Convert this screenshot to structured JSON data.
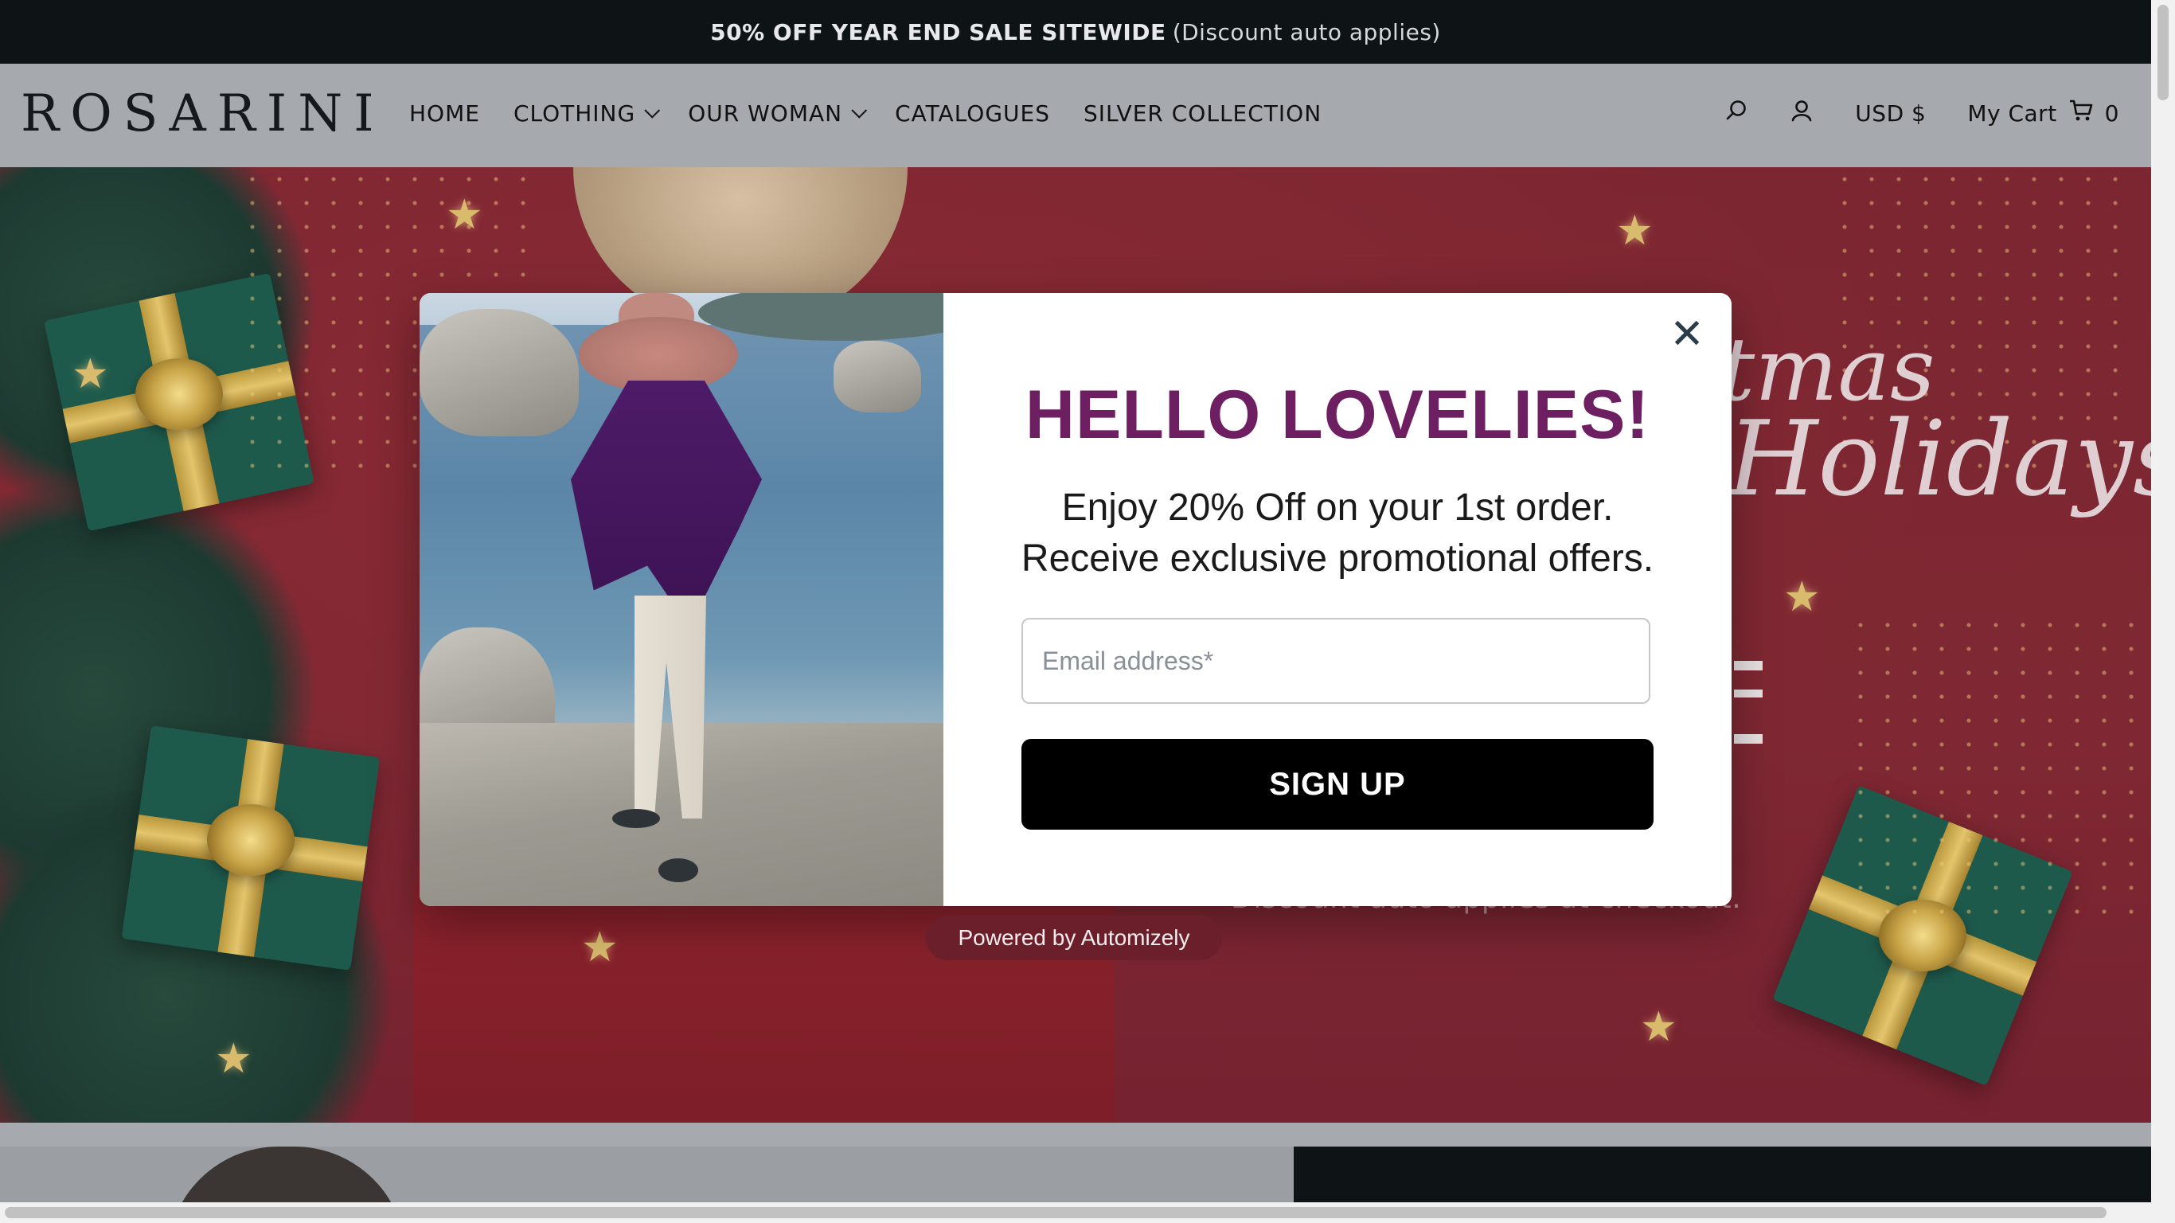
{
  "announcement": {
    "bold": "50% OFF YEAR END SALE SITEWIDE",
    "rest": "(Discount auto applies)"
  },
  "header": {
    "logo": "ROSARINI",
    "nav": [
      {
        "label": "HOME"
      },
      {
        "label": "CLOTHING"
      },
      {
        "label": "OUR WOMAN"
      },
      {
        "label": "CATALOGUES"
      },
      {
        "label": "SILVER COLLECTION"
      }
    ],
    "currency": "USD $",
    "cart_label": "My Cart",
    "cart_count": "0"
  },
  "hero": {
    "script_line1": "tmas",
    "script_line2": "Holidays",
    "note": "Discount auto applies at checkout."
  },
  "popup": {
    "headline": "HELLO LOVELIES!",
    "line1": "Enjoy 20% Off on your 1st order.",
    "line2": "Receive exclusive promotional offers.",
    "email_placeholder": "Email address*",
    "email_value": "",
    "signup_label": "SIGN UP",
    "close_symbol": "✕",
    "accent_color": "#6d1f62"
  },
  "powered_by": "Powered by Automizely",
  "icons": [
    "search-icon",
    "account-icon",
    "cart-icon",
    "close-icon",
    "chevron-down-icon"
  ]
}
